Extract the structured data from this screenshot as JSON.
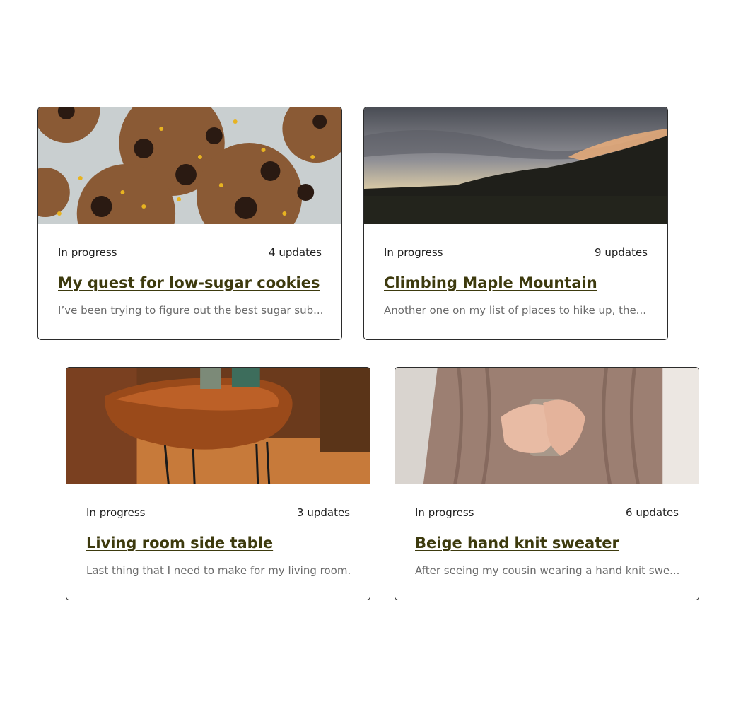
{
  "cards": [
    {
      "status": "In progress",
      "updates": "4 updates",
      "title": "My quest for low-sugar cookies",
      "excerpt": "I’ve been trying to figure out the best sugar sub...",
      "image": "cookies-photo"
    },
    {
      "status": "In progress",
      "updates": "9 updates",
      "title": "Climbing Maple Mountain",
      "excerpt": "Another one on my list of places to hike up, the...",
      "image": "mountain-sunset-photo"
    },
    {
      "status": "In progress",
      "updates": "3 updates",
      "title": "Living room side table",
      "excerpt": "Last thing that I need to make for my living room...",
      "image": "wooden-table-photo"
    },
    {
      "status": "In progress",
      "updates": "6 updates",
      "title": "Beige hand knit sweater",
      "excerpt": "After seeing my cousin wearing a hand knit swe...",
      "image": "knit-sweater-photo"
    }
  ]
}
